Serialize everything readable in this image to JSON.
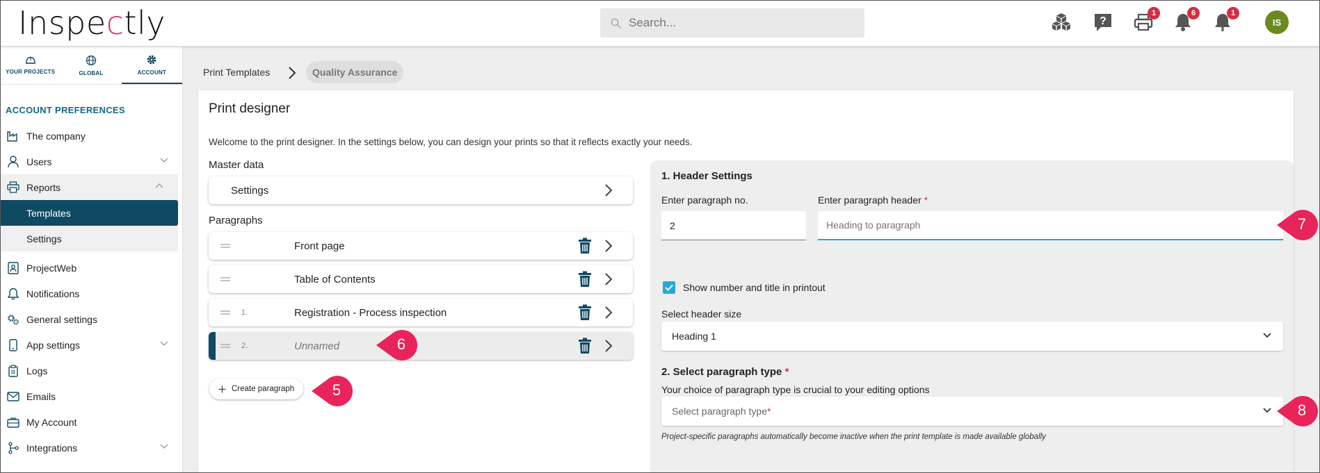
{
  "app": {
    "logo": "Inspectly"
  },
  "search": {
    "placeholder": "Search..."
  },
  "topbar": {
    "badges": {
      "print": "1",
      "bell": "6",
      "notify": "1"
    },
    "avatar": "IS"
  },
  "nav_tabs": [
    {
      "label": "YOUR PROJECTS",
      "icon": "helmet-icon"
    },
    {
      "label": "GLOBAL",
      "icon": "globe-icon"
    },
    {
      "label": "ACCOUNT",
      "icon": "gear-icon"
    }
  ],
  "sidebar": {
    "section_title": "ACCOUNT PREFERENCES",
    "items": [
      {
        "label": "The company"
      },
      {
        "label": "Users"
      },
      {
        "label": "Reports"
      },
      {
        "label": "Templates"
      },
      {
        "label": "Settings"
      },
      {
        "label": "ProjectWeb"
      },
      {
        "label": "Notifications"
      },
      {
        "label": "General settings"
      },
      {
        "label": "App settings"
      },
      {
        "label": "Logs"
      },
      {
        "label": "Emails"
      },
      {
        "label": "My Account"
      },
      {
        "label": "Integrations"
      }
    ]
  },
  "breadcrumb": {
    "parent": "Print Templates",
    "current": "Quality Assurance"
  },
  "designer": {
    "title": "Print designer",
    "intro": "Welcome to the print designer. In the settings below, you can design your prints so that it reflects exactly your needs.",
    "master_data_label": "Master data",
    "settings_label": "Settings",
    "paragraphs_label": "Paragraphs",
    "paragraphs": [
      {
        "num": "",
        "title": "Front page"
      },
      {
        "num": "",
        "title": "Table of Contents"
      },
      {
        "num": "1.",
        "title": "Registration - Process inspection"
      },
      {
        "num": "2.",
        "title": "Unnamed"
      }
    ],
    "create_button": "Create paragraph"
  },
  "header_settings": {
    "title": "1. Header Settings",
    "para_no_label": "Enter paragraph no.",
    "para_no_value": "2",
    "header_label": "Enter paragraph header",
    "header_required": "*",
    "header_placeholder": "Heading to paragraph",
    "show_checkbox_label": "Show number and title in printout",
    "header_size_label": "Select header size",
    "header_size_value": "Heading 1"
  },
  "paragraph_type": {
    "title": "2. Select paragraph type",
    "required": "*",
    "description": "Your choice of paragraph type is crucial to your editing options",
    "placeholder": "Select paragraph type",
    "hint": "Project-specific paragraphs automatically become inactive when the print template is made available globally"
  },
  "callouts": [
    "5",
    "6",
    "7",
    "8"
  ],
  "colors": {
    "primary": "#0f4a63",
    "accent": "#2a9fd6",
    "callout": "#e8245a",
    "badge": "#d32f3f"
  }
}
